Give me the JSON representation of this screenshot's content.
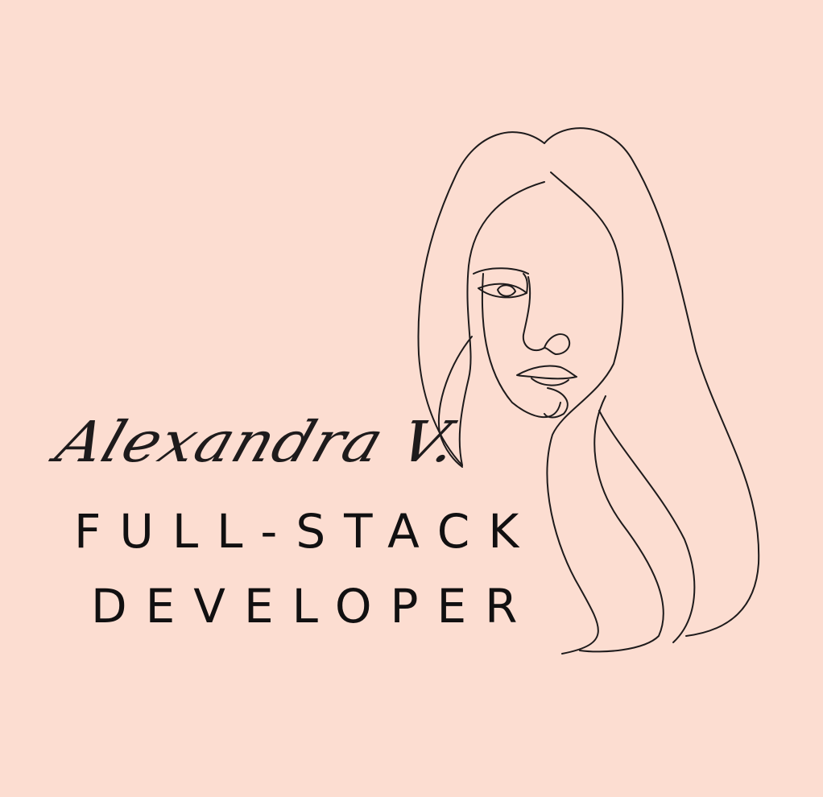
{
  "colors": {
    "background": "#fcddd1",
    "ink": "#1e1b1c"
  },
  "illustration": {
    "icon": "woman-line-art-portrait-icon"
  },
  "signature": {
    "name": "Alexandra V."
  },
  "title": {
    "line1": "FULL-STACK",
    "line2": "DEVELOPER"
  }
}
